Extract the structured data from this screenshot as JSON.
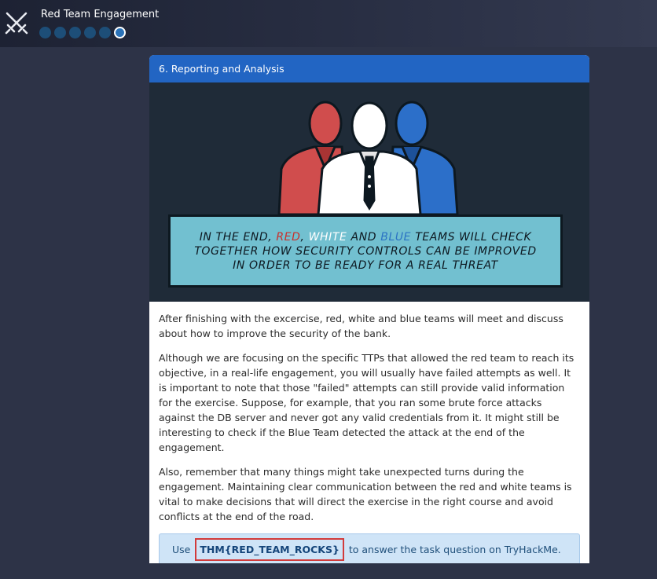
{
  "app": {
    "title": "Red Team Engagement",
    "progress": {
      "total": 6,
      "current": 6
    }
  },
  "task": {
    "header": "6. Reporting and Analysis",
    "illustration": {
      "banner_parts": [
        "IN THE END, ",
        "RED",
        ", ",
        "WHITE",
        " AND ",
        "BLUE",
        " TEAMS WILL CHECK TOGETHER HOW SECURITY CONTROLS CAN BE IMPROVED IN ORDER TO BE READY FOR A REAL THREAT"
      ]
    },
    "paragraphs": [
      "After finishing with the excercise, red, white and blue teams will meet and discuss about how to improve the security of the bank.",
      "Although we are focusing on the specific TTPs that allowed the red team to reach its objective, in a real-life engagement, you will usually have failed attempts as well. It is important to note that those \"failed\" attempts can still provide valid information for the exercise. Suppose, for example, that you ran some brute force attacks against the DB server and never got any valid credentials from it. It might still be interesting to check if the Blue Team detected the attack at the end of the engagement.",
      "Also, remember that many things might take unexpected turns during the engagement. Maintaining clear communication between the red and white teams is vital to make decisions that will direct the exercise in the right course and avoid conflicts at the end of the road."
    ],
    "answer": {
      "prefix": "Use ",
      "flag": "THM{RED_TEAM_ROCKS}",
      "suffix": " to answer the task question on TryHackMe."
    }
  },
  "colors": {
    "background": "#2d3347",
    "header": "#2265c3",
    "red_team": "#d04d4d",
    "white_team": "#ffffff",
    "blue_team": "#2c6fc9",
    "banner": "#72c0d0"
  },
  "icons": [
    "crossed-swords-icon"
  ]
}
